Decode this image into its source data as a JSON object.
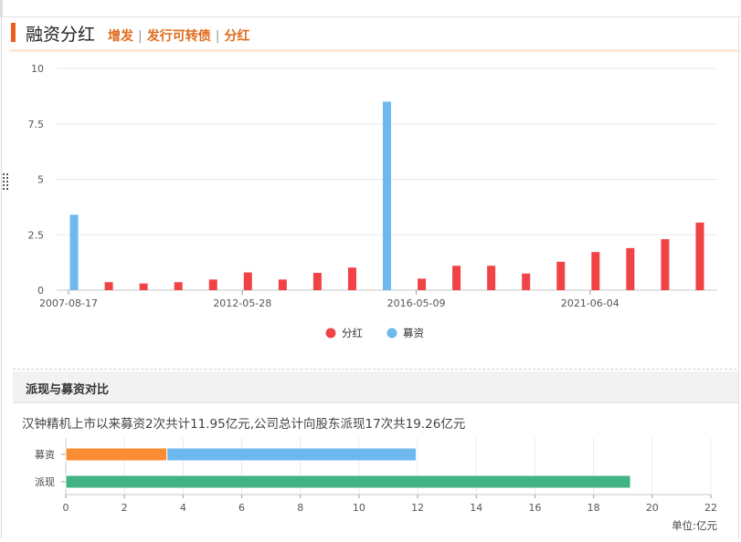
{
  "header": {
    "title": "融资分红",
    "links": [
      "增发",
      "发行可转债",
      "分红"
    ]
  },
  "colors": {
    "dividend": "#ef4345",
    "financing": "#6cb8ef",
    "payout": "#42b383",
    "financing_part1": "#fb8c34",
    "header_accent": "#e85f1c"
  },
  "chart_data": [
    {
      "type": "bar",
      "x_tick_labels": [
        "2007-08-17",
        "2012-05-28",
        "2016-05-09",
        "2021-06-04"
      ],
      "ylim": [
        0,
        10
      ],
      "yticks": [
        "0",
        "2.5",
        "5",
        "7.5",
        "10"
      ],
      "grid": true,
      "legend_placement": "bottom-center",
      "legend": [
        {
          "name": "分红",
          "color": "#ef4345"
        },
        {
          "name": "募资",
          "color": "#6cb8ef"
        }
      ],
      "bars": [
        {
          "series": "募资",
          "value": 3.4
        },
        {
          "series": "分红",
          "value": 0.36
        },
        {
          "series": "分红",
          "value": 0.3
        },
        {
          "series": "分红",
          "value": 0.36
        },
        {
          "series": "分红",
          "value": 0.48
        },
        {
          "series": "分红",
          "value": 0.8
        },
        {
          "series": "分红",
          "value": 0.48
        },
        {
          "series": "分红",
          "value": 0.78
        },
        {
          "series": "分红",
          "value": 1.02
        },
        {
          "series": "募资",
          "value": 8.5
        },
        {
          "series": "分红",
          "value": 0.52
        },
        {
          "series": "分红",
          "value": 1.1
        },
        {
          "series": "分红",
          "value": 1.1
        },
        {
          "series": "分红",
          "value": 0.75
        },
        {
          "series": "分红",
          "value": 1.28
        },
        {
          "series": "分红",
          "value": 1.72
        },
        {
          "series": "分红",
          "value": 1.9
        },
        {
          "series": "分红",
          "value": 2.3
        },
        {
          "series": "分红",
          "value": 3.05
        }
      ]
    },
    {
      "type": "bar",
      "orientation": "horizontal",
      "section_title": "派现与募资对比",
      "summary": "汉钟精机上市以来募资2次共计11.95亿元,公司总计向股东派现17次共19.26亿元",
      "categories": [
        "募资",
        "派现"
      ],
      "stacks": [
        {
          "category": "募资",
          "segments": [
            3.45,
            8.5
          ]
        },
        {
          "category": "派现",
          "segments": [
            19.26
          ]
        }
      ],
      "xlim": [
        0,
        22
      ],
      "xticks": [
        "0",
        "2",
        "4",
        "6",
        "8",
        "10",
        "12",
        "14",
        "16",
        "18",
        "20",
        "22"
      ],
      "unit": "单位:亿元",
      "grid": true
    }
  ]
}
